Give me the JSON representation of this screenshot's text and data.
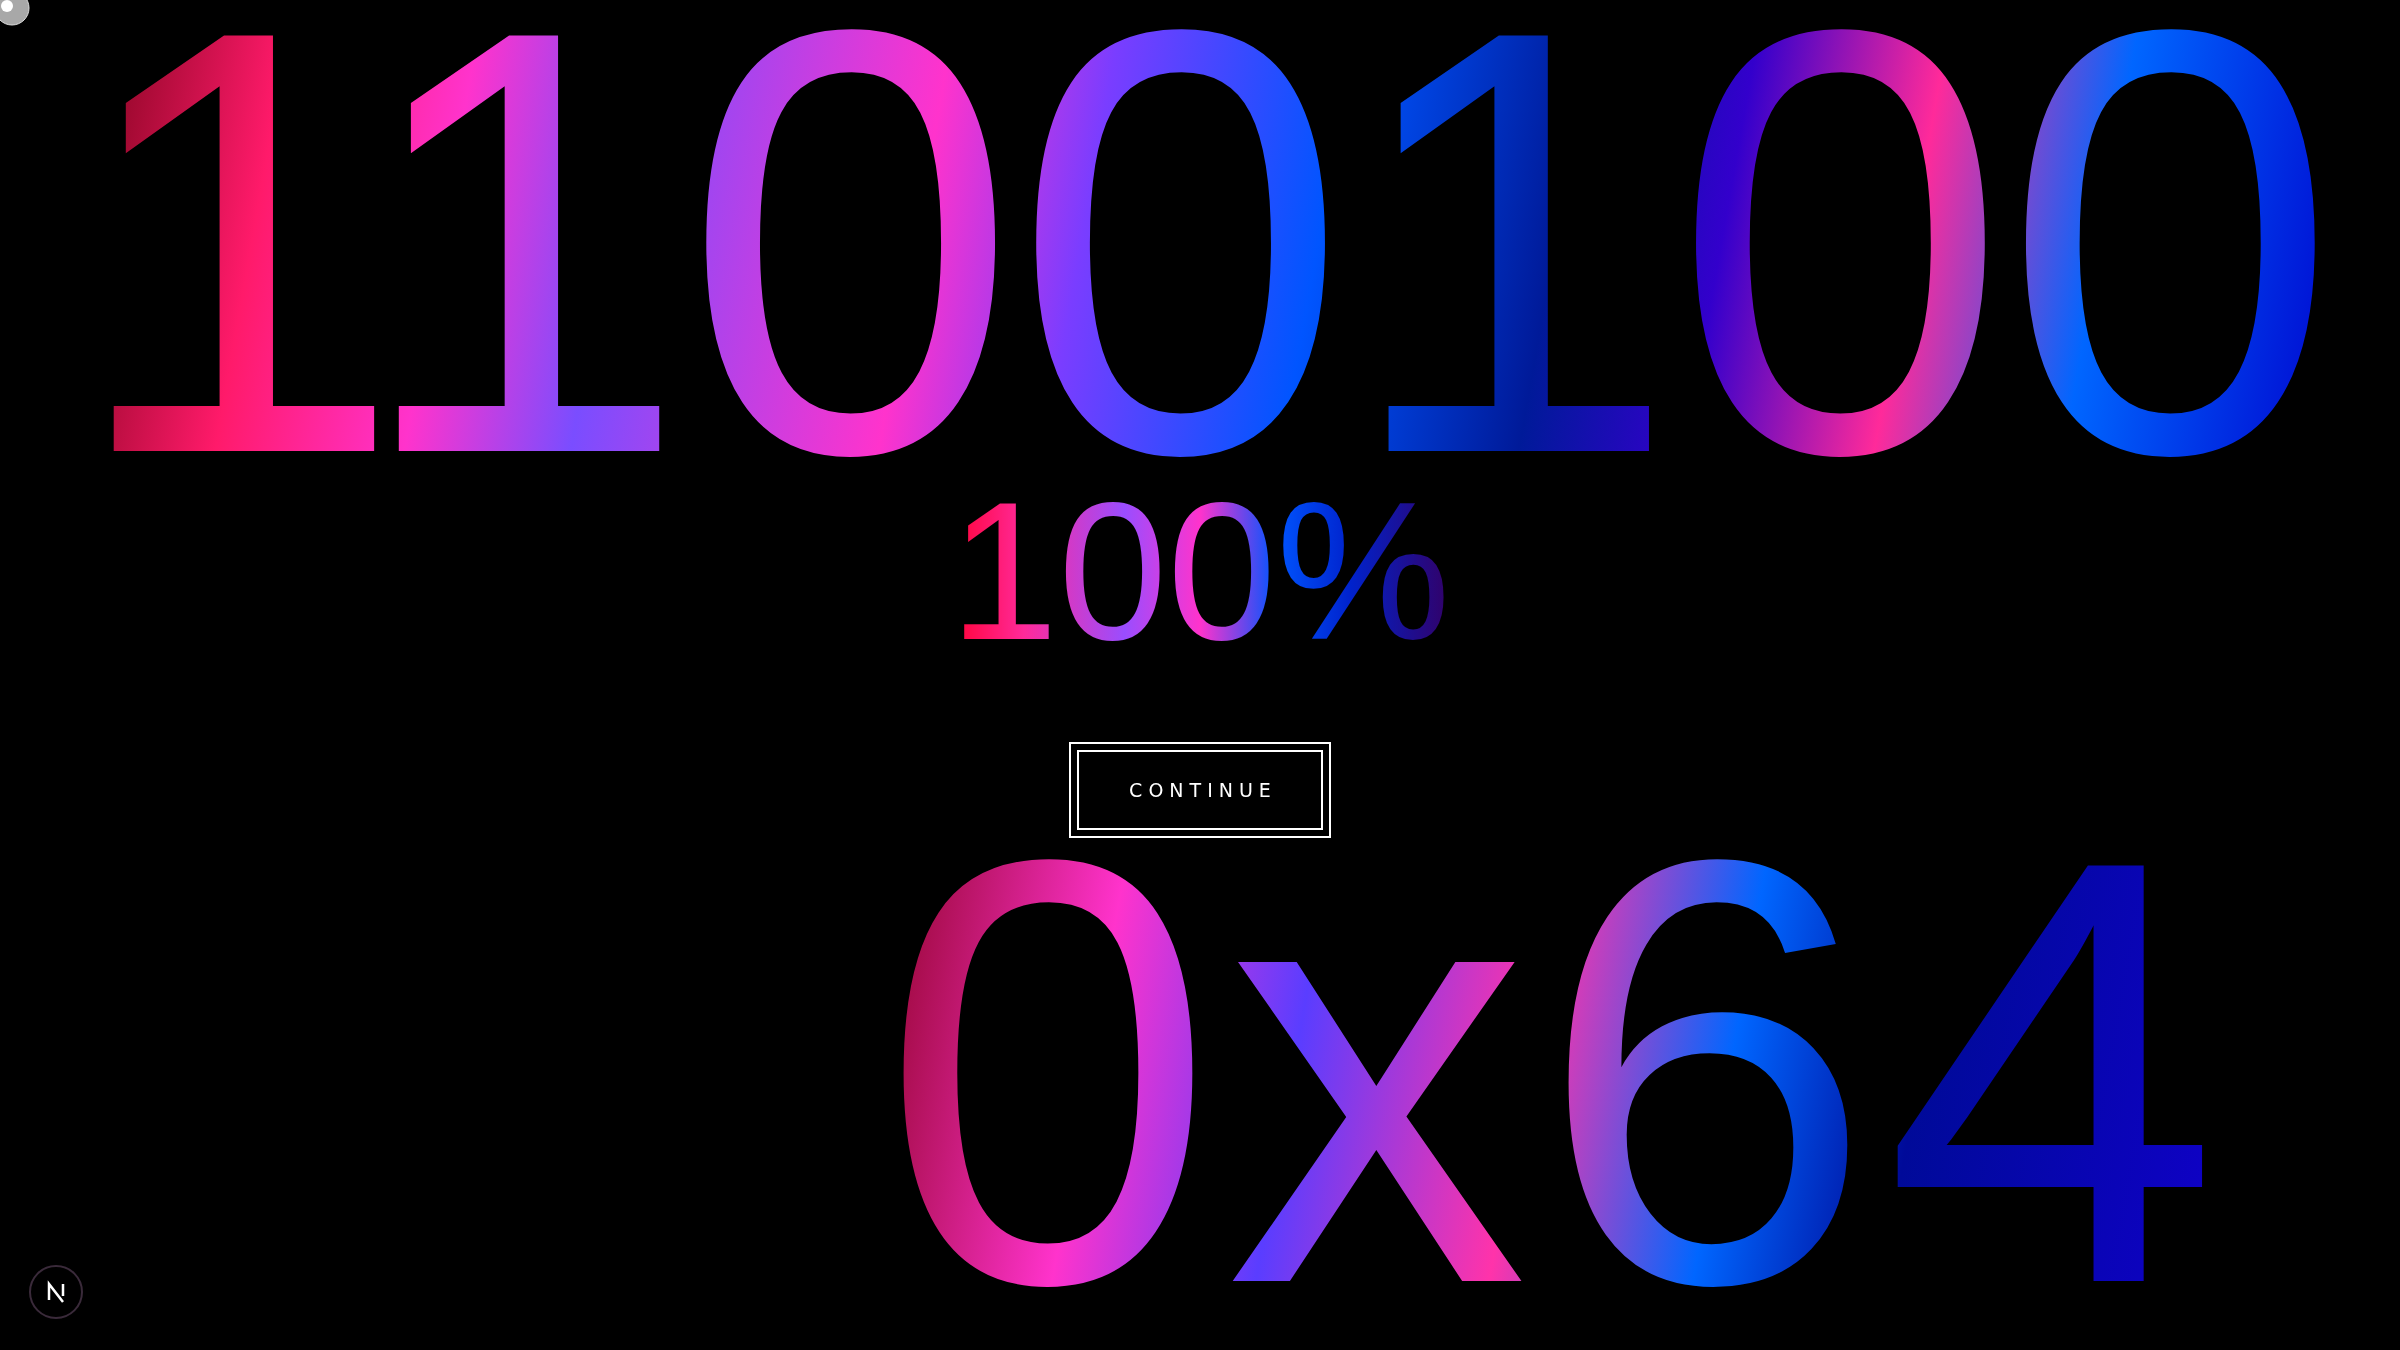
{
  "binary_value": "1100100",
  "percentage": "100%",
  "continue_button": {
    "label": "CONTINUE"
  },
  "hex_value": "0x64"
}
